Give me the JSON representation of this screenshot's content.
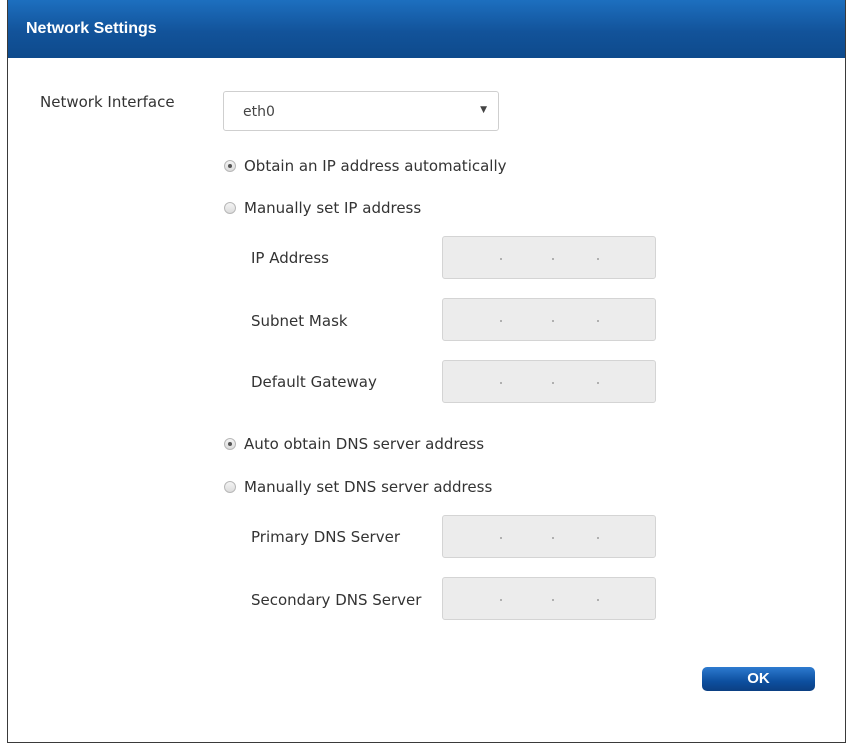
{
  "dialog": {
    "title": "Network Settings"
  },
  "network_interface": {
    "label": "Network Interface",
    "selected": "eth0"
  },
  "ip_mode": {
    "auto_label": "Obtain an IP address automatically",
    "manual_label": "Manually set IP address",
    "selected": "auto"
  },
  "ip_fields": {
    "ip_address_label": "IP Address",
    "subnet_mask_label": "Subnet Mask",
    "default_gateway_label": "Default Gateway"
  },
  "dns_mode": {
    "auto_label": "Auto obtain DNS server address",
    "manual_label": "Manually set DNS server address",
    "selected": "auto"
  },
  "dns_fields": {
    "primary_label": "Primary DNS Server",
    "secondary_label": "Secondary DNS Server"
  },
  "actions": {
    "ok_label": "OK"
  },
  "colors": {
    "title_bar": "#12539a",
    "ok_button": "#0d4f9f",
    "field_disabled_bg": "#ececec"
  }
}
